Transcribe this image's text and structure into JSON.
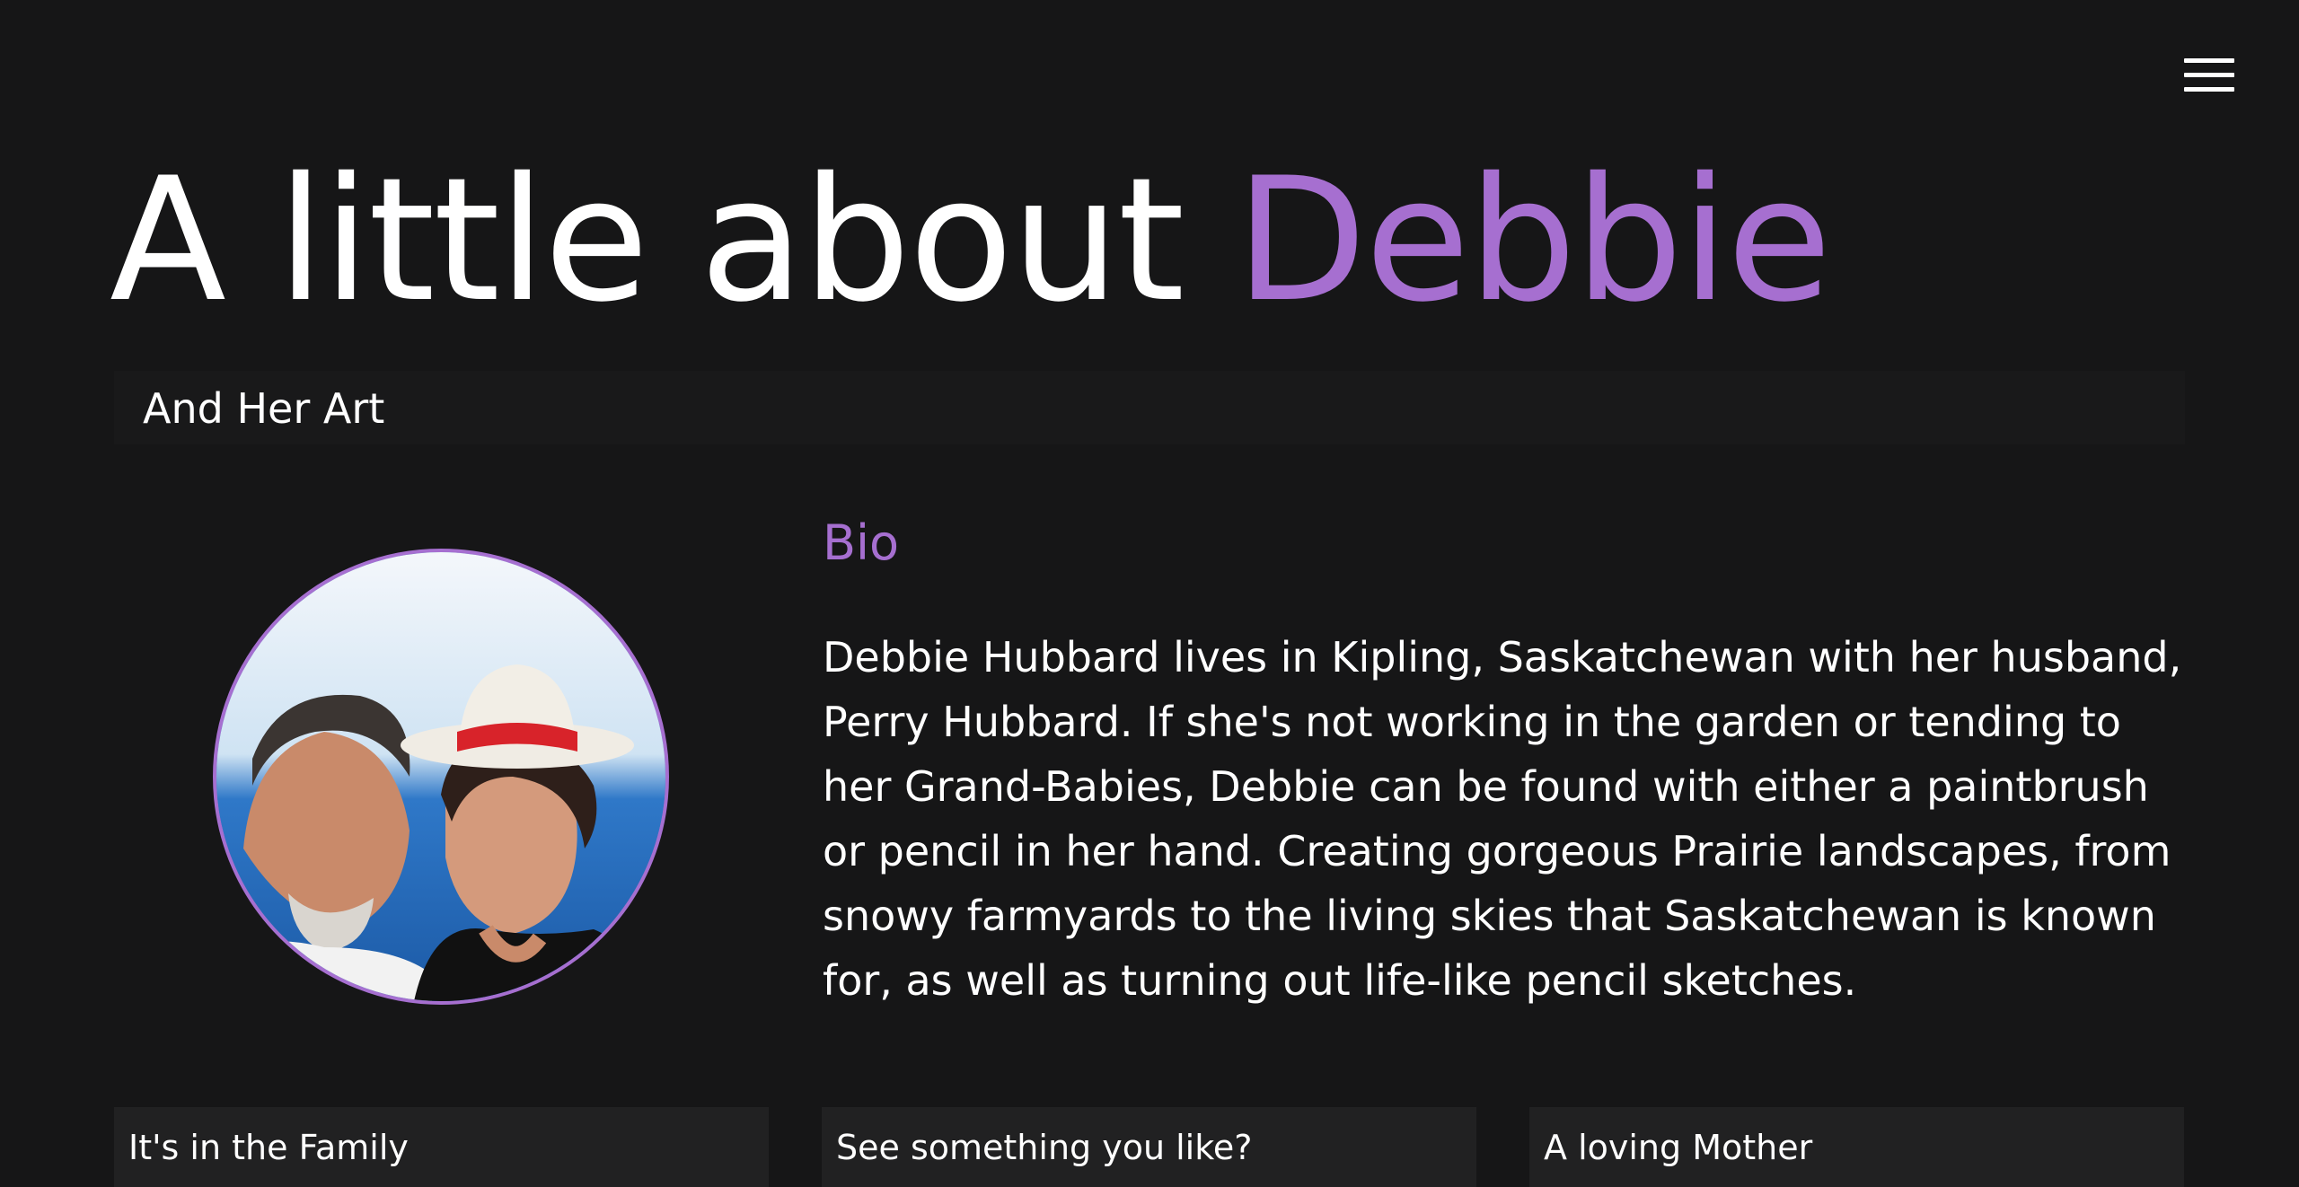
{
  "nav": {
    "menu_icon": "hamburger-menu-icon"
  },
  "hero": {
    "title_prefix": "A little about ",
    "title_name": "Debbie",
    "subtitle": "And Her Art"
  },
  "colors": {
    "accent": "#a66fd0",
    "background": "#161617",
    "subtitle_bar": "#19191a",
    "card_background": "#212122"
  },
  "bio": {
    "heading": "Bio",
    "text": "Debbie Hubbard lives in Kipling, Saskatchewan with her husband, Perry Hubbard. If she's not working in the garden or tending to her Grand-Babies, Debbie can be found with either a paintbrush or pencil in her hand. Creating gorgeous Prairie landscapes, from snowy farmyards to the living skies that Saskatchewan is known for, as well as turning out life-like pencil sketches."
  },
  "cards": [
    {
      "title": "It's in the Family"
    },
    {
      "title": "See something you like?"
    },
    {
      "title": "A loving Mother"
    }
  ]
}
